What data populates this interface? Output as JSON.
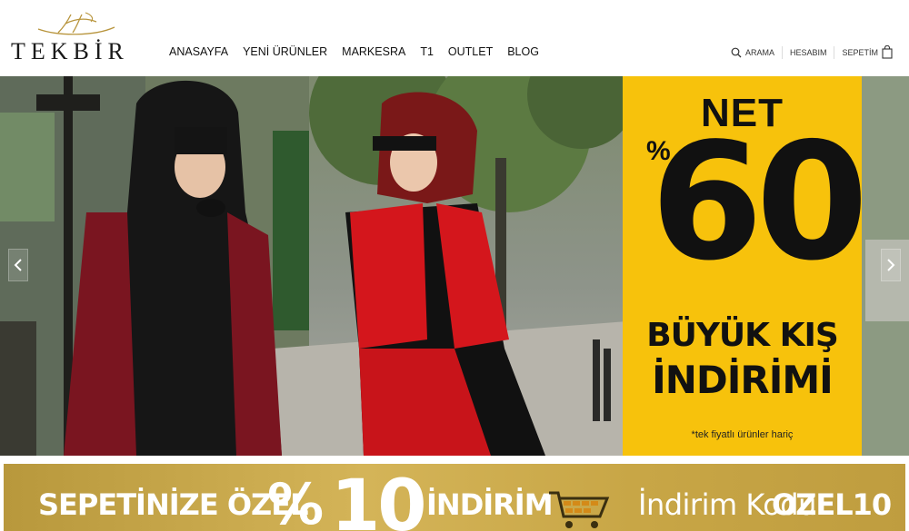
{
  "brand": {
    "name": "TEKBİR"
  },
  "nav": [
    {
      "label": "ANASAYFA"
    },
    {
      "label": "YENİ ÜRÜNLER"
    },
    {
      "label": "MARKESRA"
    },
    {
      "label": "T1"
    },
    {
      "label": "OUTLET"
    },
    {
      "label": "BLOG"
    }
  ],
  "utility": {
    "search_label": "ARAMA",
    "account_label": "HESABIM",
    "cart_label": "SEPETİM"
  },
  "hero": {
    "promo": {
      "net": "NET",
      "percent_sign": "%",
      "number": "60",
      "line1": "BÜYÜK KIŞ",
      "line2": "İNDİRİMİ",
      "note": "*tek fiyatlı ürünler hariç",
      "bg_color": "#f7c20c"
    }
  },
  "banner": {
    "text1": "SEPETİNİZE ÖZEL",
    "percent_sign": "%",
    "number": "10",
    "text2": "İNDİRİM",
    "code_label": "İndirim Kodu:",
    "code": "OZEL10"
  },
  "icons": [
    "logo-mark-icon",
    "search-icon",
    "cart-icon",
    "chevron-left-icon",
    "chevron-right-icon",
    "shopping-cart-icon"
  ]
}
